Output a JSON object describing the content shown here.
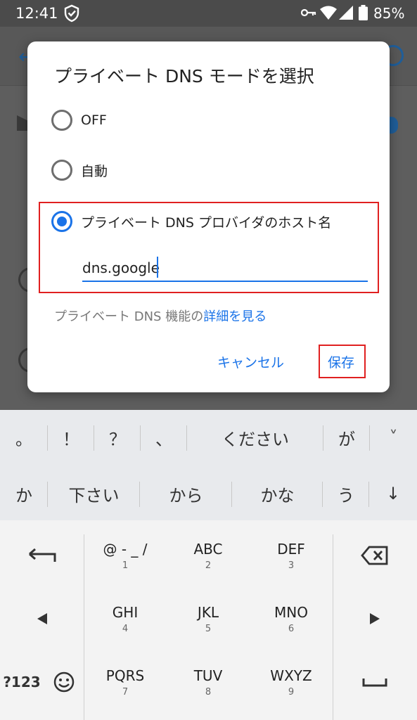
{
  "status_bar": {
    "time": "12:41",
    "battery_percent": "85%",
    "icons": [
      "shield-icon",
      "vpn-key-icon",
      "wifi-icon",
      "signal-icon",
      "battery-icon"
    ]
  },
  "dialog": {
    "title": "プライベート DNS モードを選択",
    "options": [
      {
        "label": "OFF",
        "selected": false
      },
      {
        "label": "自動",
        "selected": false
      },
      {
        "label": "プライベート DNS プロバイダのホスト名",
        "selected": true
      }
    ],
    "hostname_value": "dns.google",
    "info_text": "プライベート DNS 機能の",
    "info_link": "詳細を見る",
    "cancel_label": "キャンセル",
    "save_label": "保存"
  },
  "keyboard": {
    "suggestions_row1": [
      "。",
      "！",
      "？",
      "、",
      "ください",
      "が",
      "˅"
    ],
    "suggestions_row2": [
      "か",
      "下さい",
      "から",
      "かな",
      "う",
      "↓"
    ],
    "keys": [
      {
        "main": "@ - _ /",
        "sub": "1"
      },
      {
        "main": "ABC",
        "sub": "2"
      },
      {
        "main": "DEF",
        "sub": "3"
      },
      {
        "main": "GHI",
        "sub": "4"
      },
      {
        "main": "JKL",
        "sub": "5"
      },
      {
        "main": "MNO",
        "sub": "6"
      },
      {
        "main": "PQRS",
        "sub": "7"
      },
      {
        "main": "TUV",
        "sub": "8"
      },
      {
        "main": "WXYZ",
        "sub": "9"
      }
    ],
    "mode_label": "?123"
  },
  "colors": {
    "accent": "#1a73e8",
    "highlight": "#e02020"
  }
}
